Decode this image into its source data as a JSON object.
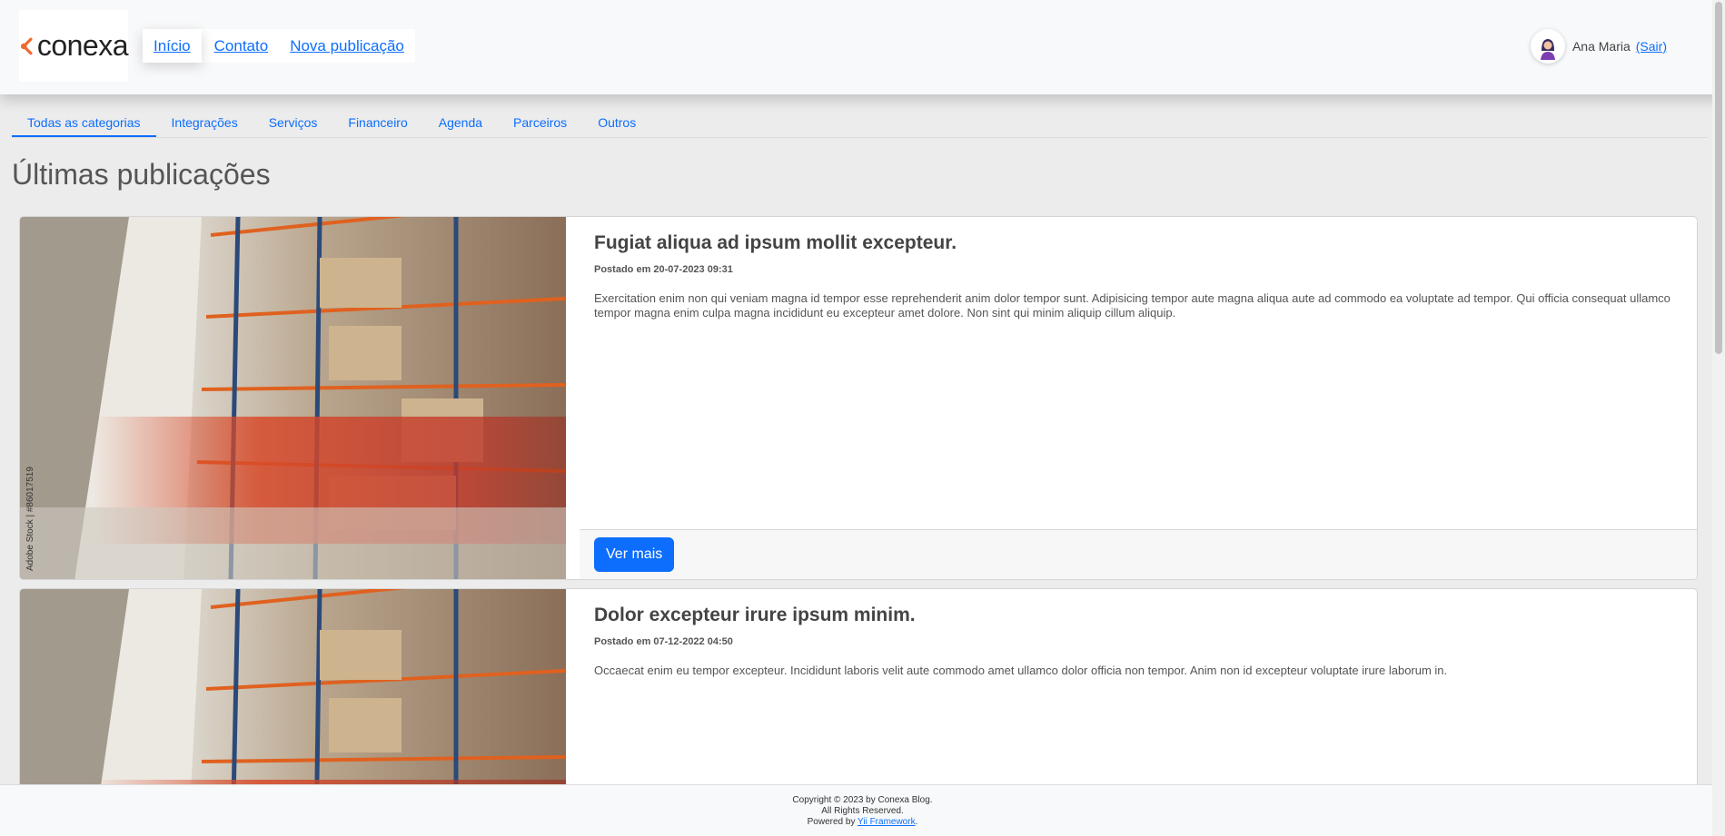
{
  "brand": {
    "name": "conexa"
  },
  "nav": {
    "items": [
      {
        "label": "Início",
        "active": true
      },
      {
        "label": "Contato",
        "active": false
      },
      {
        "label": "Nova publicação",
        "active": false
      }
    ]
  },
  "user": {
    "name": "Ana Maria",
    "logout_label": "(Sair)"
  },
  "categories": [
    {
      "label": "Todas as categorias",
      "active": true
    },
    {
      "label": "Integrações",
      "active": false
    },
    {
      "label": "Serviços",
      "active": false
    },
    {
      "label": "Financeiro",
      "active": false
    },
    {
      "label": "Agenda",
      "active": false
    },
    {
      "label": "Parceiros",
      "active": false
    },
    {
      "label": "Outros",
      "active": false
    }
  ],
  "page": {
    "title": "Últimas publicações"
  },
  "posts": [
    {
      "title": "Fugiat aliqua ad ipsum mollit excepteur.",
      "date": "Postado em 20-07-2023 09:31",
      "text": "Exercitation enim non qui veniam magna id tempor esse reprehenderit anim dolor tempor sunt. Adipisicing tempor aute magna aliqua aute ad commodo ea voluptate ad tempor. Qui officia consequat ullamco tempor magna enim culpa magna incididunt eu excepteur amet dolore. Non sint qui minim aliquip cillum aliquip.",
      "button": "Ver mais",
      "image_watermark": "Adobe Stock | #86017519"
    },
    {
      "title": "Dolor excepteur irure ipsum minim.",
      "date": "Postado em 07-12-2022 04:50",
      "text": "Occaecat enim eu tempor excepteur. Incididunt laboris velit aute commodo amet ullamco dolor officia non tempor. Anim non id excepteur voluptate irure laborum in."
    }
  ],
  "footer": {
    "copyright": "Copyright © 2023 by Conexa Blog.",
    "rights": "All Rights Reserved.",
    "powered_prefix": "Powered by ",
    "powered_link": "Yii Framework",
    "powered_suffix": "."
  },
  "colors": {
    "accent": "#0d6efd",
    "logo": "#ee6a2f"
  }
}
